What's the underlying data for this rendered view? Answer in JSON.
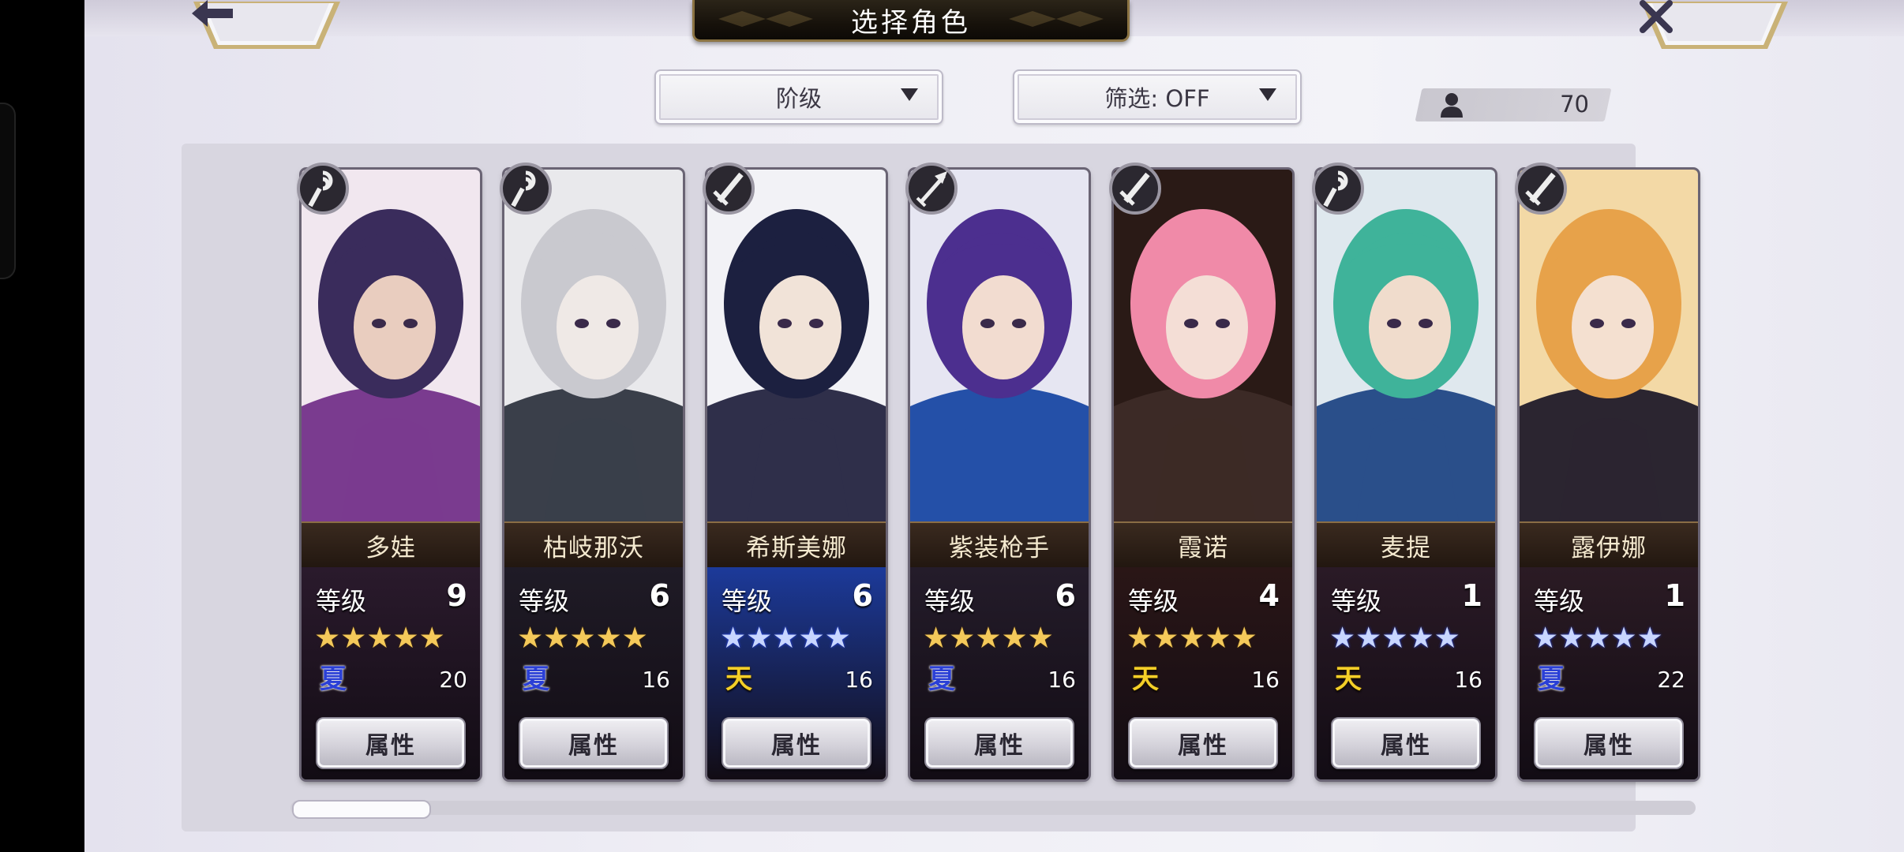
{
  "header": {
    "title": "选择角色",
    "back_icon": "arrow-left-icon",
    "close_icon": "close-x-icon"
  },
  "filters": {
    "sort_label": "阶级",
    "filter_label": "筛选: OFF"
  },
  "roster_count": "70",
  "attribute_button_label": "属性",
  "level_label": "等级",
  "star_glyphs": "★★★★★",
  "scroll_progress": 0.08,
  "colors": {
    "gold_star": "#f4c95a",
    "silver_star": "#c8d6ff",
    "blue_element": "#2a3fd6",
    "gold_element": "#f4cf28"
  },
  "characters": [
    {
      "name": "多娃",
      "level": "9",
      "stars": 5,
      "star_color": "gold",
      "element": "夏",
      "element_color": "blue",
      "cost": "20",
      "class_icon": "staff-icon",
      "stats_bg": "#2a1a2c"
    },
    {
      "name": "枯岐那沃",
      "level": "6",
      "stars": 5,
      "star_color": "gold",
      "element": "夏",
      "element_color": "blue",
      "cost": "16",
      "class_icon": "staff-icon",
      "stats_bg": "#1f1b26"
    },
    {
      "name": "希斯美娜",
      "level": "6",
      "stars": 5,
      "star_color": "silver",
      "element": "天",
      "element_color": "gold",
      "cost": "16",
      "class_icon": "sword-icon",
      "stats_bg": "#1c3a9a"
    },
    {
      "name": "紫装枪手",
      "level": "6",
      "stars": 5,
      "star_color": "gold",
      "element": "夏",
      "element_color": "blue",
      "cost": "16",
      "class_icon": "arrow-icon",
      "stats_bg": "#241c2a"
    },
    {
      "name": "霞诺",
      "level": "4",
      "stars": 5,
      "star_color": "gold",
      "element": "天",
      "element_color": "gold",
      "cost": "16",
      "class_icon": "sword-icon",
      "stats_bg": "#2a1616"
    },
    {
      "name": "麦提",
      "level": "1",
      "stars": 5,
      "star_color": "silver",
      "element": "天",
      "element_color": "gold",
      "cost": "16",
      "class_icon": "staff-icon",
      "stats_bg": "#2a1a26"
    },
    {
      "name": "露伊娜",
      "level": "1",
      "stars": 5,
      "star_color": "silver",
      "element": "夏",
      "element_color": "blue",
      "cost": "22",
      "class_icon": "sword-icon",
      "stats_bg": "#2b1b24"
    }
  ]
}
